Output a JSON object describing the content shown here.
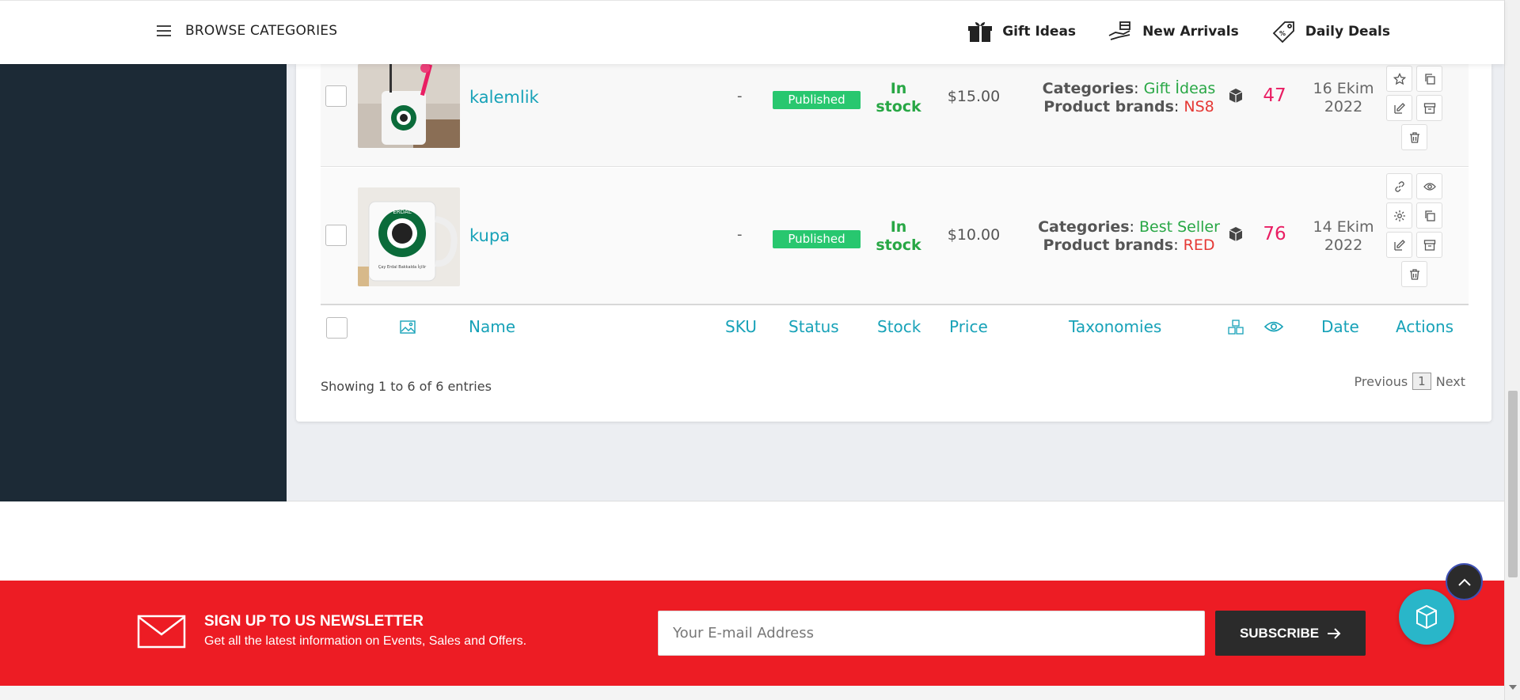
{
  "topnav": {
    "browse_label": "BROWSE CATEGORIES",
    "links": [
      {
        "label": "Gift Ideas",
        "icon": "gift-icon"
      },
      {
        "label": "New Arrivals",
        "icon": "hand-box-icon"
      },
      {
        "label": "Daily Deals",
        "icon": "price-tag-icon"
      }
    ]
  },
  "products": [
    {
      "name": "kalemlik",
      "sku": "-",
      "status": "Published",
      "stock_line1": "In",
      "stock_line2": "stock",
      "price": "$15.00",
      "categories_label": "Categories",
      "categories_value": "Gift İdeas",
      "brands_label": "Product brands",
      "brands_value": "NS8",
      "views": "47",
      "date_line1": "16 Ekim",
      "date_line2": "2022"
    },
    {
      "name": "kupa",
      "sku": "-",
      "status": "Published",
      "stock_line1": "In",
      "stock_line2": "stock",
      "price": "$10.00",
      "categories_label": "Categories",
      "categories_value": "Best Seller",
      "brands_label": "Product brands",
      "brands_value": "RED",
      "views": "76",
      "date_line1": "14 Ekim",
      "date_line2": "2022"
    }
  ],
  "table_headers": {
    "name": "Name",
    "sku": "SKU",
    "status": "Status",
    "stock": "Stock",
    "price": "Price",
    "taxonomies": "Taxonomies",
    "date": "Date",
    "actions": "Actions"
  },
  "pagination": {
    "showing": "Showing 1 to 6 of 6 entries",
    "previous": "Previous",
    "page": "1",
    "next": "Next"
  },
  "newsletter": {
    "title": "SIGN UP TO US NEWSLETTER",
    "subtitle": "Get all the latest information on Events, Sales and Offers.",
    "placeholder": "Your E-mail Address",
    "button": "SUBSCRIBE"
  },
  "colors": {
    "accent": "#17a2b8",
    "sidebar": "#1c2a36",
    "newsletter_bg": "#ed1c24",
    "published": "#28c76f",
    "stock": "#28a745",
    "views": "#e91e63"
  }
}
